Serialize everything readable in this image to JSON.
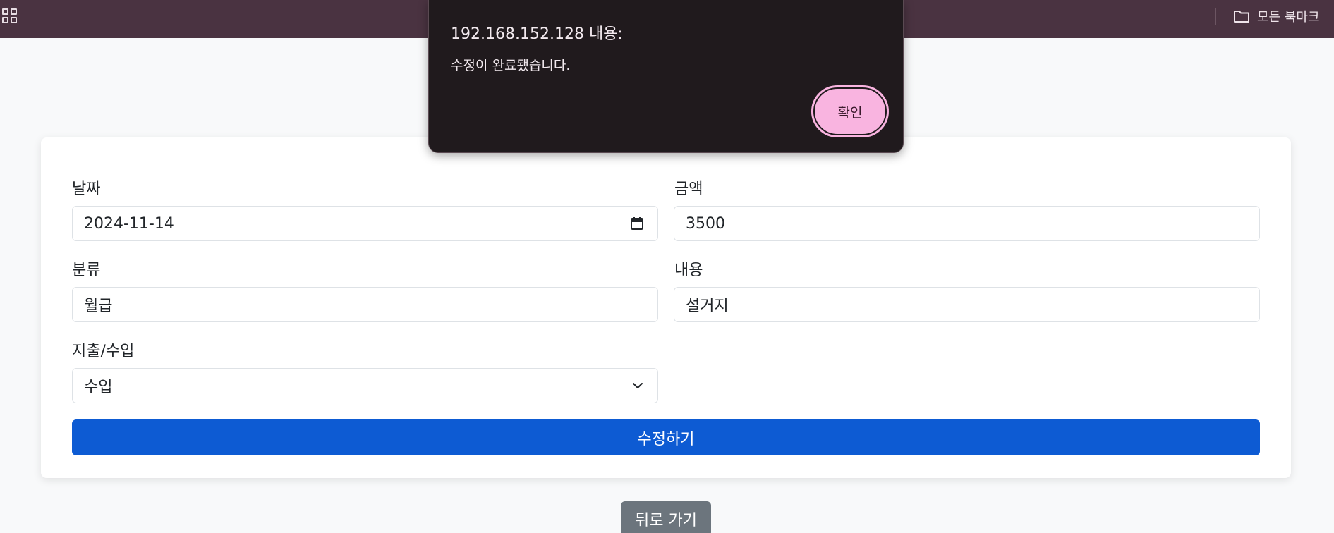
{
  "browser": {
    "bookmarks_label": "모든 북마크"
  },
  "dialog": {
    "title": "192.168.152.128 내용:",
    "message": "수정이 완료됐습니다.",
    "ok_label": "확인"
  },
  "form": {
    "date_label": "날짜",
    "date_value": "2024-11-14",
    "amount_label": "금액",
    "amount_value": "3500",
    "category_label": "분류",
    "category_value": "월급",
    "content_label": "내용",
    "content_value": "설거지",
    "type_label": "지출/수입",
    "type_value": "수입",
    "submit_label": "수정하기"
  },
  "back_label": "뒤로 가기",
  "colors": {
    "topbar": "#4a3341",
    "primary": "#0d5bd3",
    "secondary": "#6c757d",
    "dialog_bg": "#201a1d",
    "dialog_button": "#f9b4e0"
  },
  "icons": [
    "apps-grid-icon",
    "folder-icon",
    "calendar-icon",
    "chevron-down-icon"
  ]
}
